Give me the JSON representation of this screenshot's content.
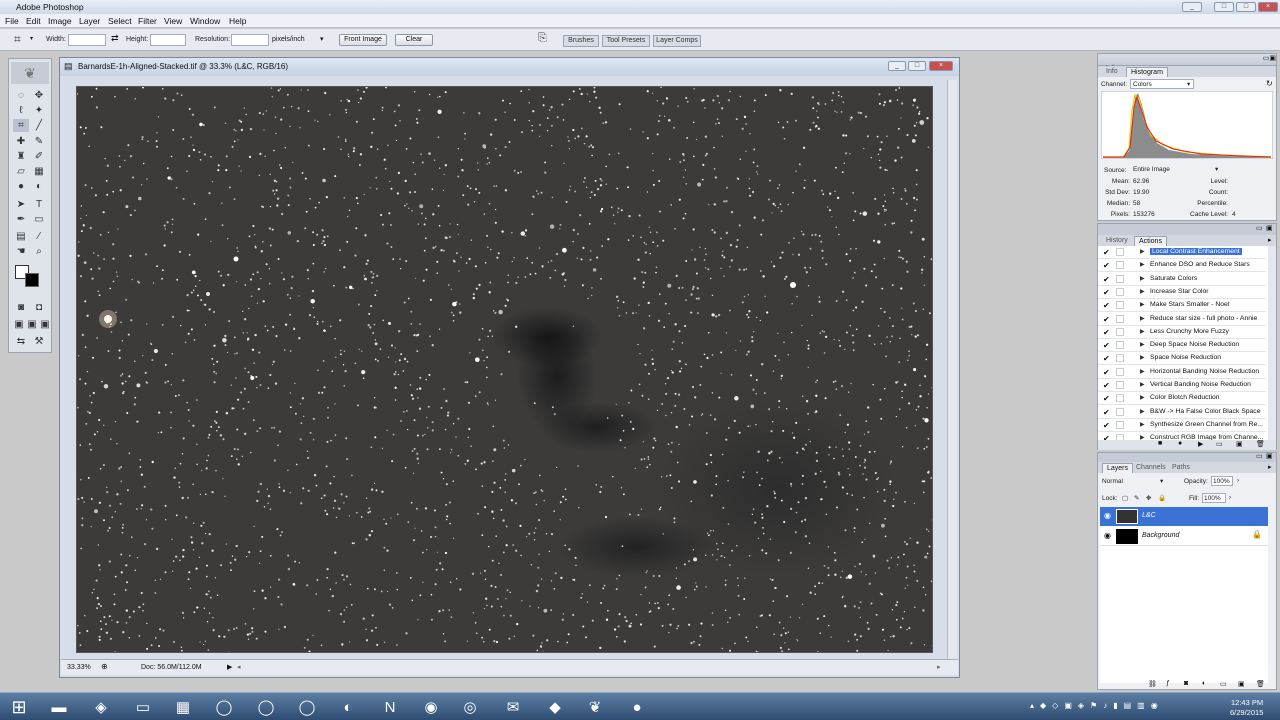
{
  "app": {
    "title": "Adobe Photoshop"
  },
  "window_buttons": [
    "_",
    "□",
    "×"
  ],
  "menu": [
    "File",
    "Edit",
    "Image",
    "Layer",
    "Select",
    "Filter",
    "View",
    "Window",
    "Help"
  ],
  "options": {
    "width_label": "Width:",
    "height_label": "Height:",
    "resolution_label": "Resolution:",
    "units": "pixels/inch",
    "front_image": "Front Image",
    "clear": "Clear",
    "tabs": [
      "Brushes",
      "Tool Presets",
      "Layer Comps"
    ]
  },
  "document": {
    "title": "BarnardsE-1h-Aligned-Stacked.tif @ 33.3% (L&C, RGB/16)",
    "zoom": "33.33%",
    "doc_info": "Doc: 56.0M/112.0M"
  },
  "histogram": {
    "tabs": [
      "Info",
      "Histogram"
    ],
    "channel_label": "Channel:",
    "channel_value": "Colors",
    "source_label": "Source:",
    "source_value": "Entire Image",
    "stats_left": [
      {
        "label": "Mean:",
        "value": "62.96"
      },
      {
        "label": "Std Dev:",
        "value": "19.90"
      },
      {
        "label": "Median:",
        "value": "58"
      },
      {
        "label": "Pixels:",
        "value": "153276"
      }
    ],
    "stats_right": [
      {
        "label": "Level:",
        "value": ""
      },
      {
        "label": "Count:",
        "value": ""
      },
      {
        "label": "Percentile:",
        "value": ""
      },
      {
        "label": "Cache Level:",
        "value": "4"
      }
    ]
  },
  "actions": {
    "tabs": [
      "History",
      "Actions"
    ],
    "items": [
      {
        "name": "Local Contrast Enhancement",
        "selected": true
      },
      {
        "name": "Enhance DSO and Reduce Stars"
      },
      {
        "name": "Saturate Colors"
      },
      {
        "name": "Increase Star Color"
      },
      {
        "name": "Make Stars Smaller - Noel"
      },
      {
        "name": "Reduce star size - full photo - Annie"
      },
      {
        "name": "Less Crunchy More Fuzzy"
      },
      {
        "name": "Deep Space Noise Reduction"
      },
      {
        "name": "Space Noise Reduction"
      },
      {
        "name": "Horizontal Banding Noise Reduction"
      },
      {
        "name": "Vertical Banding Noise Reduction"
      },
      {
        "name": "Color Blotch Reduction"
      },
      {
        "name": "B&W -> Ha False Color Black Space"
      },
      {
        "name": "Synthesize Green Channel from Re..."
      },
      {
        "name": "Construct RGB Image from Channe..."
      }
    ]
  },
  "layers": {
    "tabs": [
      "Layers",
      "Channels",
      "Paths"
    ],
    "blend_mode": "Normal",
    "opacity_label": "Opacity:",
    "opacity": "100%",
    "lock_label": "Lock:",
    "fill_label": "Fill:",
    "fill": "100%",
    "items": [
      {
        "name": "L&C",
        "selected": true
      },
      {
        "name": "Background",
        "locked": true
      }
    ]
  },
  "taskbar": {
    "time": "12:43 PM",
    "date": "6/29/2015"
  }
}
